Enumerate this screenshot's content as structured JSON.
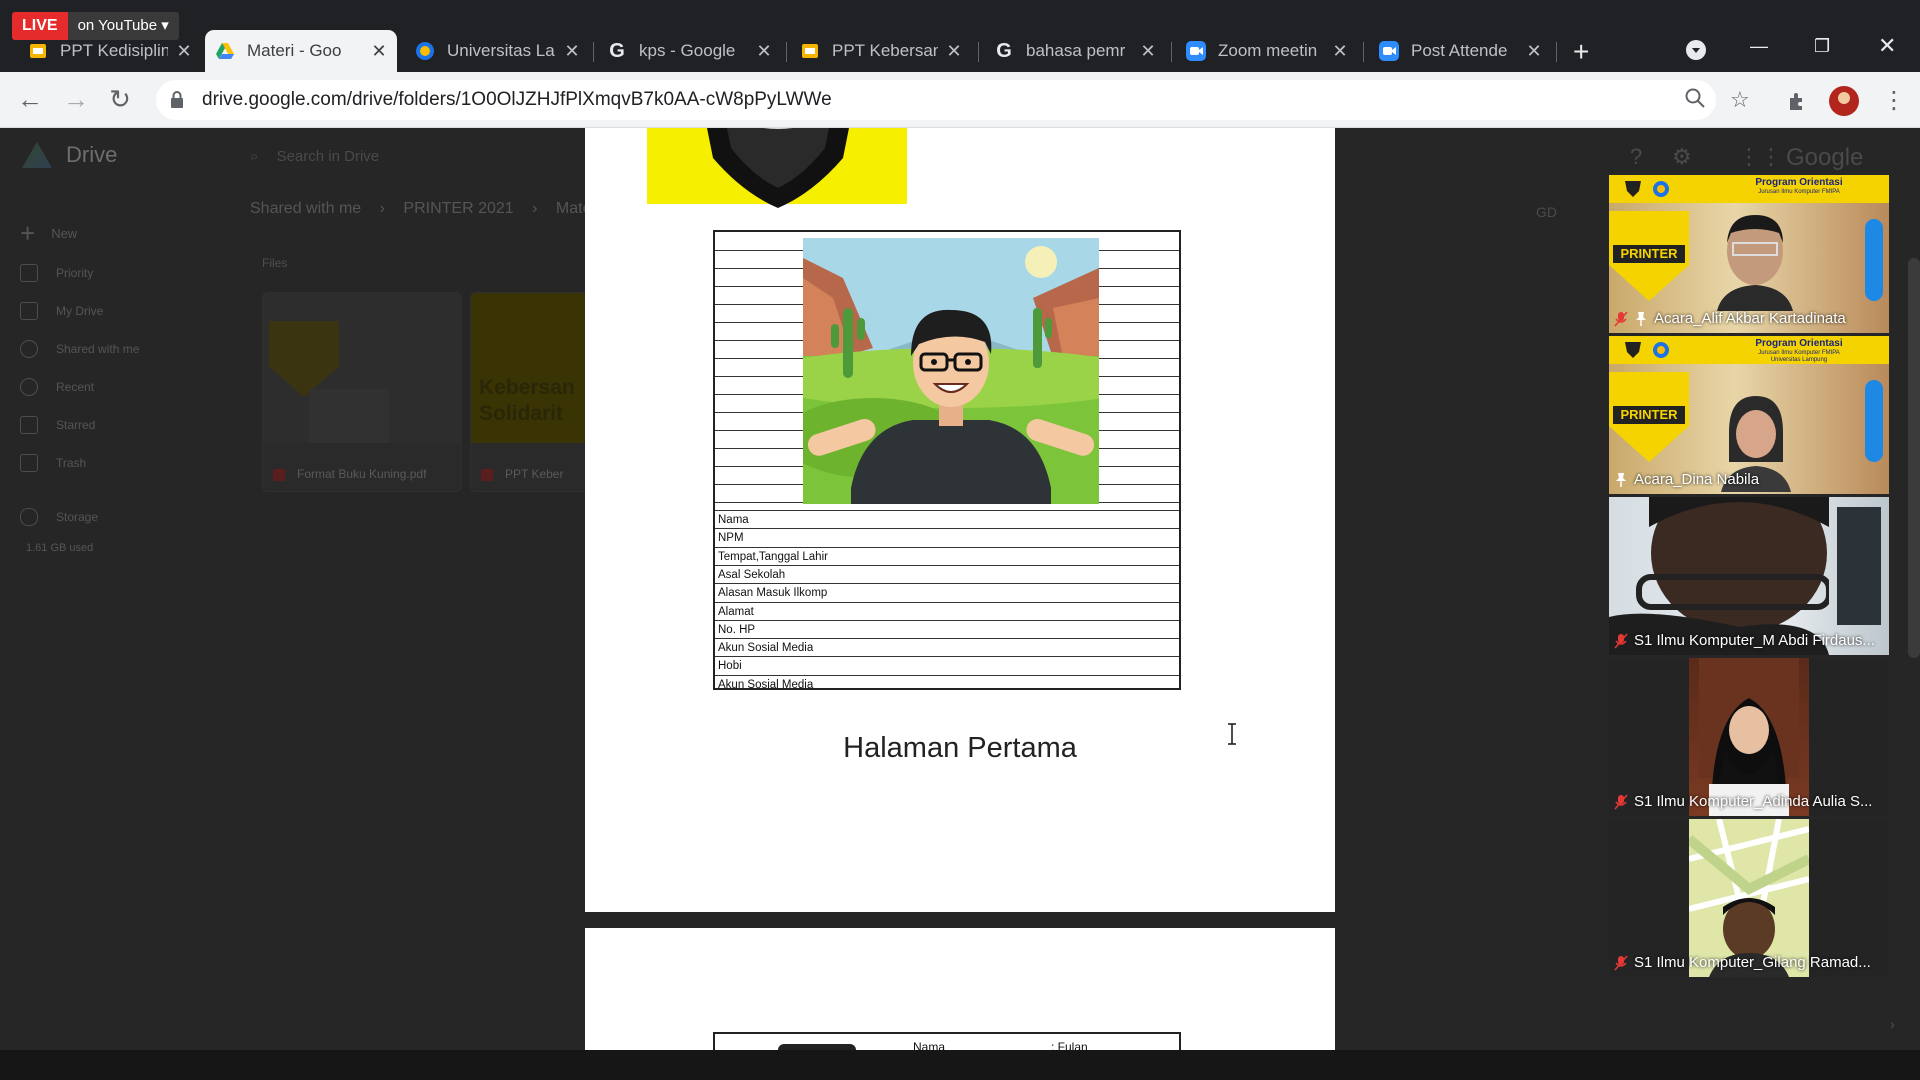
{
  "browser": {
    "live": {
      "badge": "LIVE",
      "label": "on YouTube"
    },
    "tabs": [
      {
        "title": "PPT Kedisiplin",
        "icon": "slides-icon",
        "active": false
      },
      {
        "title": "Materi - Goo",
        "icon": "drive-icon",
        "active": true
      },
      {
        "title": "Universitas La",
        "icon": "university-icon",
        "active": false
      },
      {
        "title": "kps - Google",
        "icon": "google-icon",
        "active": false
      },
      {
        "title": "PPT Kebersan",
        "icon": "slides-icon",
        "active": false
      },
      {
        "title": "bahasa pemr",
        "icon": "google-icon",
        "active": false
      },
      {
        "title": "Zoom meetin",
        "icon": "zoom-icon",
        "active": false
      },
      {
        "title": "Post Attende",
        "icon": "zoom-icon",
        "active": false
      }
    ],
    "url": "drive.google.com/drive/folders/1O0OlJZHJfPlXmqvB7k0AA-cW8pPyLWWe"
  },
  "drive": {
    "brand": "Drive",
    "search_placeholder": "Search in Drive",
    "sidebar": [
      {
        "label": "New"
      },
      {
        "label": "Priority"
      },
      {
        "label": "My Drive"
      },
      {
        "label": "Shared with me"
      },
      {
        "label": "Recent"
      },
      {
        "label": "Starred"
      },
      {
        "label": "Trash"
      },
      {
        "label": "Storage"
      }
    ],
    "storage_used": "1.61 GB used",
    "breadcrumb": [
      "Shared with me",
      "PRINTER 2021",
      "Mate"
    ],
    "files_label": "Files",
    "files": [
      {
        "name": "Format Buku Kuning.pdf"
      },
      {
        "name": "PPT Keber"
      }
    ],
    "card_preview_text": "Kebersan Solidarit",
    "brand_top_right": "Google"
  },
  "document": {
    "form_fields": [
      "Nama",
      "NPM",
      "Tempat,Tanggal Lahir",
      "Asal Sekolah",
      "Alasan Masuk Ilkomp",
      "Alamat",
      "No. HP",
      "Akun Sosial Media",
      "Hobi",
      "Akun Sosial Media"
    ],
    "caption": "Halaman Pertama",
    "page2": {
      "label": "Nama",
      "value": ": Fulan"
    }
  },
  "zoom": {
    "banner_title": "Program Orientasi",
    "banner_sub": "Jurusan Ilmu Komputer FMIPA",
    "banner_sub2": "Universitas Lampung",
    "logo_text": "PRINTER",
    "participants": [
      {
        "name": "Acara_Alif Akbar Kartadinata",
        "muted": true,
        "type": "banner"
      },
      {
        "name": "Acara_Dina Nabila",
        "muted": false,
        "type": "banner"
      },
      {
        "name": "S1 Ilmu Komputer_M Abdi Firdaus...",
        "muted": true,
        "type": "camera"
      },
      {
        "name": "S1 Ilmu Komputer_Adinda Aulia S...",
        "muted": true,
        "type": "narrow"
      },
      {
        "name": "S1 Ilmu Komputer_Gilang Ramad...",
        "muted": true,
        "type": "narrow-map"
      }
    ]
  },
  "colors": {
    "live_red": "#e52b2b",
    "doc_yellow": "#f7ef00",
    "banner_yellow": "#f5d300"
  }
}
